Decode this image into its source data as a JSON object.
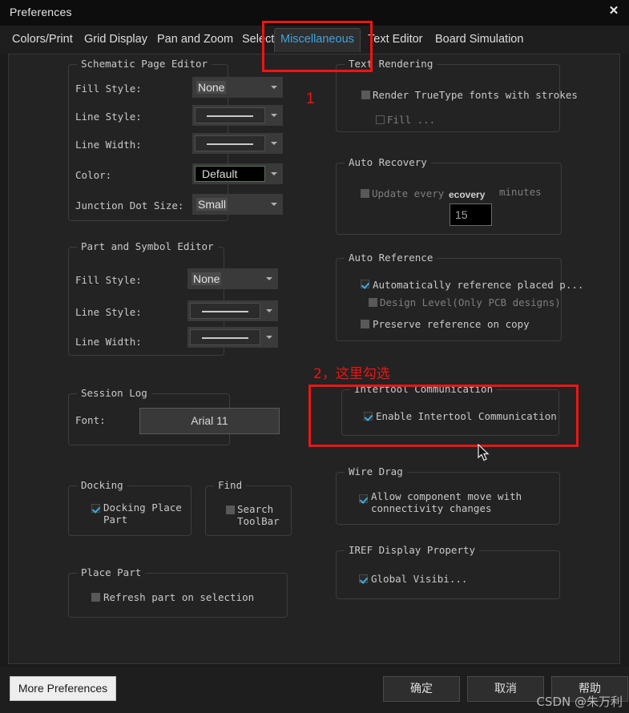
{
  "window": {
    "title": "Preferences",
    "close_icon": "close-icon"
  },
  "tabs": [
    {
      "label": "Colors/Print",
      "active": false
    },
    {
      "label": "Grid Display",
      "active": false
    },
    {
      "label": "Pan and Zoom",
      "active": false
    },
    {
      "label": "Select",
      "active": false
    },
    {
      "label": "Miscellaneous",
      "active": true
    },
    {
      "label": "Text Editor",
      "active": false
    },
    {
      "label": "Board Simulation",
      "active": false
    }
  ],
  "left_column": {
    "schematic_page_editor": {
      "title": "Schematic Page Editor",
      "fields": [
        {
          "label": "Fill Style:",
          "value": "None",
          "type": "text"
        },
        {
          "label": "Line Style:",
          "value": "",
          "type": "line"
        },
        {
          "label": "Line Width:",
          "value": "",
          "type": "line"
        },
        {
          "label": "Color:",
          "value": "Default",
          "type": "color"
        },
        {
          "label": "Junction Dot Size:",
          "value": "Small",
          "type": "text"
        }
      ]
    },
    "part_and_symbol_editor": {
      "title": "Part and Symbol Editor",
      "fields": [
        {
          "label": "Fill Style:",
          "value": "None",
          "type": "text"
        },
        {
          "label": "Line Style:",
          "value": "",
          "type": "line"
        },
        {
          "label": "Line Width:",
          "value": "",
          "type": "line"
        }
      ]
    },
    "session_log": {
      "title": "Session Log",
      "font_label": "Font:",
      "font_value": "Arial 11"
    },
    "docking": {
      "title": "Docking",
      "checkbox_label": "Docking Place\nPart",
      "checked": true
    },
    "find": {
      "title": "Find",
      "checkbox_label": "Search\nToolBar",
      "checked": false
    },
    "place_part": {
      "title": "Place Part",
      "checkbox_label": "Refresh part on selection",
      "checked": false
    }
  },
  "right_column": {
    "text_rendering": {
      "title": "Text Rendering",
      "truetype_label": "Render TrueType fonts with strokes",
      "truetype_checked": false,
      "fill_label": "Fill ...",
      "fill_checked": false
    },
    "auto_recovery": {
      "title": "Auto Recovery",
      "update_label": "Update every",
      "update_checked": false,
      "ghost_text": "ecovery",
      "minutes_label": "minutes",
      "interval_value": "15"
    },
    "auto_reference": {
      "title": "Auto Reference",
      "items": [
        {
          "label": "Automatically reference placed p...",
          "checked": true
        },
        {
          "label": "Design Level(Only PCB designs)",
          "checked": false
        },
        {
          "label": "Preserve reference on copy",
          "checked": false
        }
      ]
    },
    "intertool_communication": {
      "title": "Intertool Communication",
      "checkbox_label": "Enable Intertool Communication",
      "checked": true
    },
    "wire_drag": {
      "title": "Wire Drag",
      "checkbox_label": "Allow component move with\nconnectivity changes",
      "checked": true
    },
    "iref_display_property": {
      "title": "IREF Display Property",
      "checkbox_label": "Global Visibi...",
      "checked": true
    }
  },
  "annotations": {
    "step1_number": "1",
    "step2_text": "2，这里勾选",
    "accent_color": "#f01414"
  },
  "footer": {
    "more_preferences": "More Preferences",
    "ok": "确定",
    "cancel": "取消",
    "help": "帮助",
    "watermark": "CSDN @朱万利"
  }
}
